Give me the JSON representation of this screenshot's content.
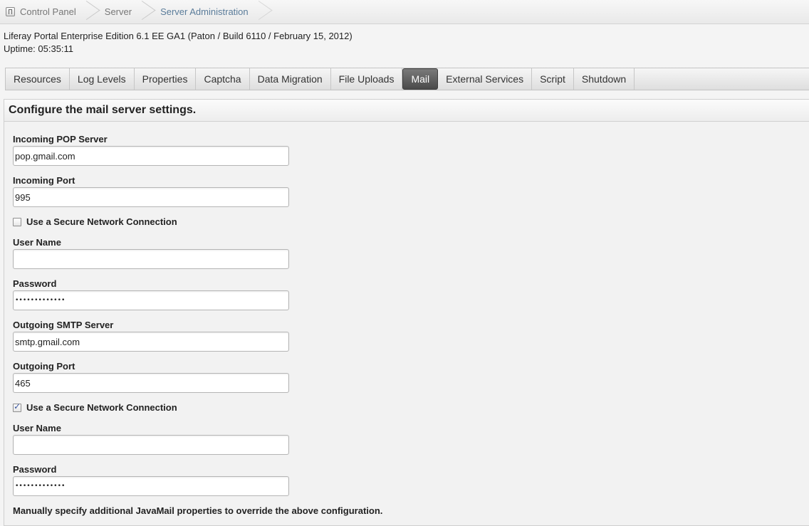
{
  "breadcrumb": {
    "items": [
      "Control Panel",
      "Server",
      "Server Administration"
    ]
  },
  "info": {
    "edition": "Liferay Portal Enterprise Edition 6.1 EE GA1 (Paton / Build 6110 / February 15, 2012)",
    "uptime": "Uptime: 05:35:11"
  },
  "tabs": [
    "Resources",
    "Log Levels",
    "Properties",
    "Captcha",
    "Data Migration",
    "File Uploads",
    "Mail",
    "External Services",
    "Script",
    "Shutdown"
  ],
  "active_tab": "Mail",
  "panel": {
    "title": "Configure the mail server settings.",
    "incoming_pop_label": "Incoming POP Server",
    "incoming_pop_value": "pop.gmail.com",
    "incoming_port_label": "Incoming Port",
    "incoming_port_value": "995",
    "incoming_secure_label": "Use a Secure Network Connection",
    "incoming_secure_checked": false,
    "incoming_user_label": "User Name",
    "incoming_user_value": "",
    "incoming_password_label": "Password",
    "incoming_password_value": "•••••••••••••",
    "outgoing_smtp_label": "Outgoing SMTP Server",
    "outgoing_smtp_value": "smtp.gmail.com",
    "outgoing_port_label": "Outgoing Port",
    "outgoing_port_value": "465",
    "outgoing_secure_label": "Use a Secure Network Connection",
    "outgoing_secure_checked": true,
    "outgoing_user_label": "User Name",
    "outgoing_user_value": "",
    "outgoing_password_label": "Password",
    "outgoing_password_value": "•••••••••••••",
    "javamail_note": "Manually specify additional JavaMail properties to override the above configuration."
  },
  "icons": {
    "home": "control-panel-icon"
  }
}
